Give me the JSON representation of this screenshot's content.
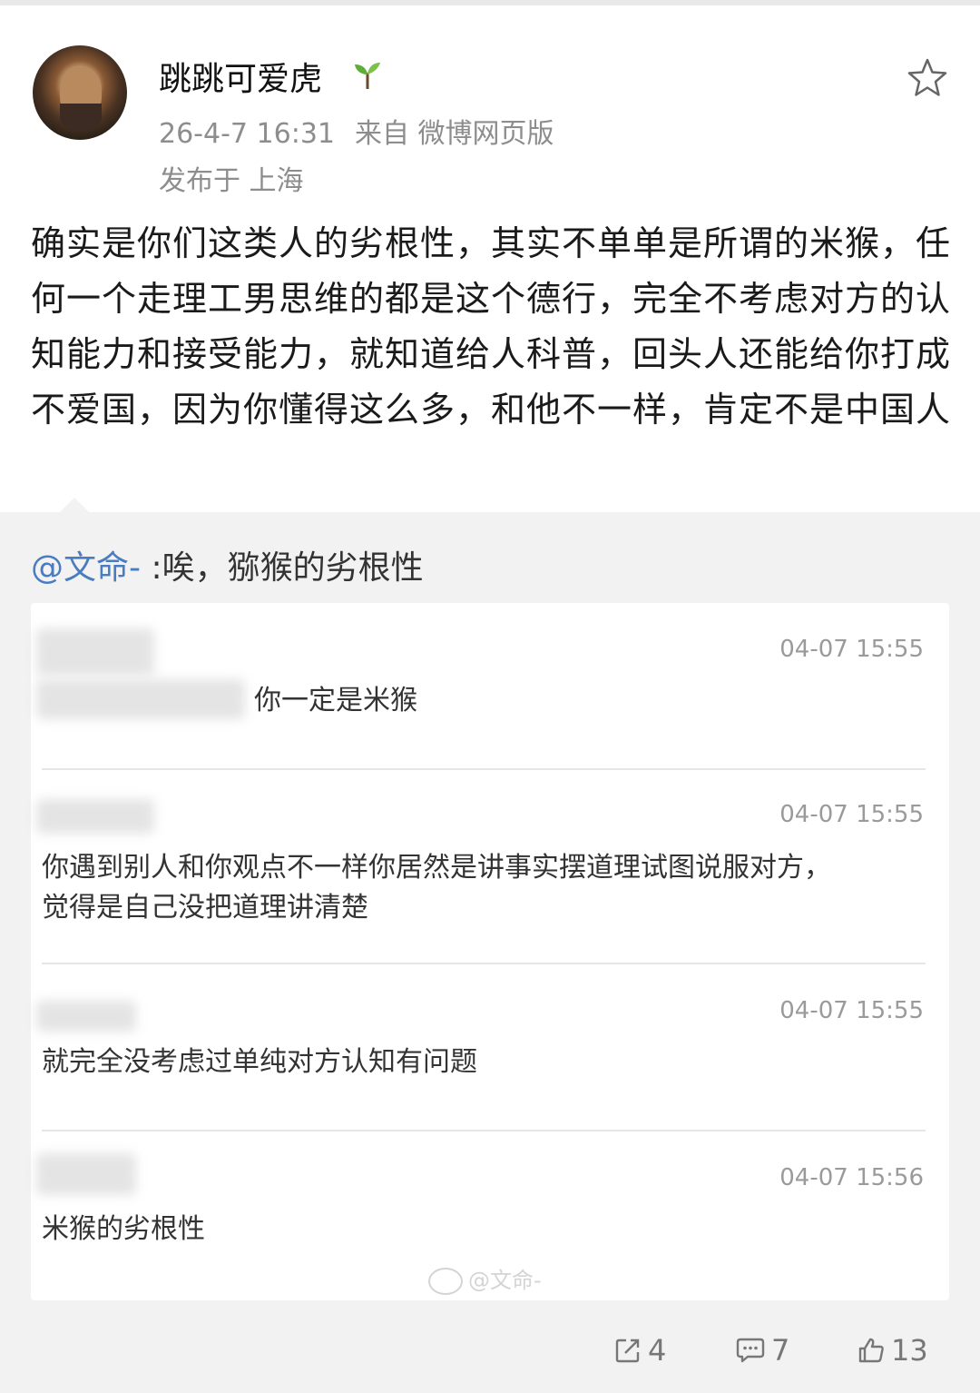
{
  "post": {
    "user_name": "跳跳可爱虎",
    "timestamp": "26-4-7 16:31",
    "source": "来自 微博网页版",
    "location": "发布于 上海",
    "text": "确实是你们这类人的劣根性，其实不单单是所谓的米猴，任何一个走理工男思维的都是这个德行，完全不考虑对方的认知能力和接受能力，就知道给人科普，回头人还能给你打成不爱国，因为你懂得这么多，和他不一样，肯定不是中国人"
  },
  "repost": {
    "mention": "@文命-",
    "text": " :唉，猕猴的劣根性"
  },
  "image_comments": [
    {
      "time": "04-07 15:55",
      "text": "你一定是米猴"
    },
    {
      "time": "04-07 15:55",
      "text": "你遇到别人和你观点不一样你居然是讲事实摆道理试图说服对方，觉得是自己没把道理讲清楚"
    },
    {
      "time": "04-07 15:55",
      "text": "就完全没考虑过单纯对方认知有问题"
    },
    {
      "time": "04-07 15:56",
      "text": "米猴的劣根性"
    }
  ],
  "watermark": "@文命-",
  "actions": {
    "repost_count": "4",
    "comment_count": "7",
    "like_count": "13"
  },
  "colors": {
    "mention": "#4a7cc0",
    "meta_gray": "#8d8d8d",
    "background": "#f2f2f2"
  }
}
